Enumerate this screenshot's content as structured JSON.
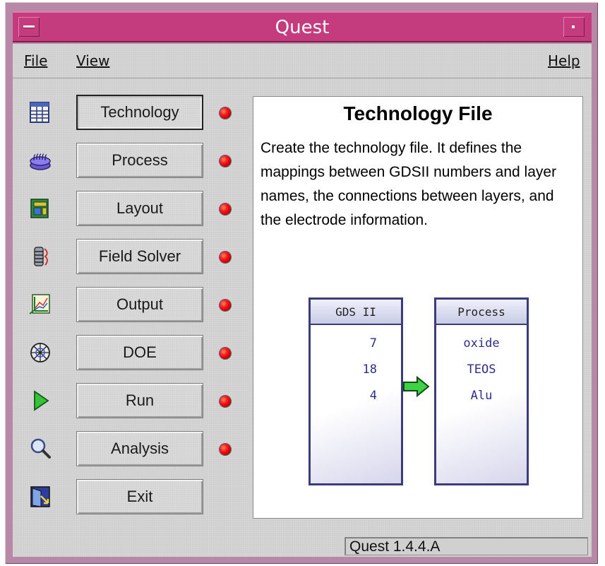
{
  "window": {
    "title": "Quest"
  },
  "menu": {
    "file": "File",
    "view": "View",
    "help": "Help"
  },
  "sidebar": {
    "items": [
      {
        "label": "Technology",
        "icon": "table-icon"
      },
      {
        "label": "Process",
        "icon": "layers-icon"
      },
      {
        "label": "Layout",
        "icon": "layout-icon"
      },
      {
        "label": "Field Solver",
        "icon": "coil-icon"
      },
      {
        "label": "Output",
        "icon": "plot-icon"
      },
      {
        "label": "DOE",
        "icon": "grid-target-icon"
      },
      {
        "label": "Run",
        "icon": "play-icon"
      },
      {
        "label": "Analysis",
        "icon": "magnifier-icon"
      },
      {
        "label": "Exit",
        "icon": "exit-door-icon"
      }
    ],
    "status_led_color": "#ff1a1a"
  },
  "panel": {
    "title": "Technology File",
    "description": "Create the technology file. It defines the mappings between GDSII numbers and layer names, the connections between layers, and the electrode information.",
    "gds_box": {
      "header": "GDS II",
      "rows": [
        "7",
        "18",
        "4"
      ]
    },
    "process_box": {
      "header": "Process",
      "rows": [
        "oxide",
        "TEOS",
        "Alu"
      ]
    }
  },
  "statusbar": {
    "text": "Quest 1.4.4.A"
  },
  "colors": {
    "titlebar": "#c43c7d",
    "frame": "#b889a6",
    "client": "#cfcfcf",
    "box_border": "#3b3c7a"
  }
}
